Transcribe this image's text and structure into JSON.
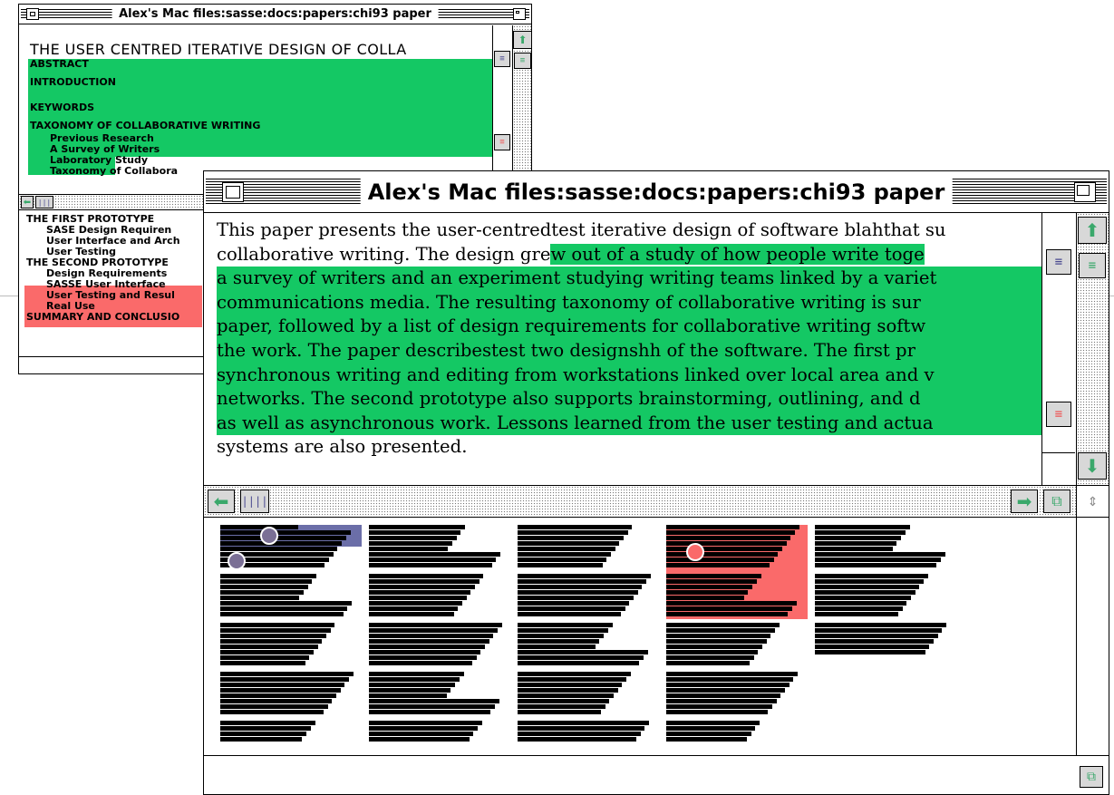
{
  "colors": {
    "highlight_green": "#14c864",
    "highlight_red": "#fa6a6a",
    "overview_purple": "#6b6ea8",
    "scroll_green": "#3aa86b"
  },
  "outline_window": {
    "title": "Alex's Mac files:sasse:docs:papers:chi93 paper",
    "heading": "THE USER CENTRED ITERATIVE DESIGN OF COLLA",
    "items_top": [
      {
        "label": "ABSTRACT",
        "level": 0
      },
      {
        "label": "INTRODUCTION",
        "level": 0
      },
      {
        "label": "KEYWORDS",
        "level": 0
      },
      {
        "label": "TAXONOMY OF COLLABORATIVE WRITING",
        "level": 0
      },
      {
        "label": "Previous Research",
        "level": 1
      },
      {
        "label": "A Survey  of Writers",
        "level": 1
      },
      {
        "label": "Laboratory Study",
        "level": 1
      },
      {
        "label": "Taxonomy of Collabora",
        "level": 1
      }
    ],
    "items_bottom": [
      {
        "label": "THE FIRST PROTOTYPE",
        "level": 0
      },
      {
        "label": "SASE Design Requiren",
        "level": 1
      },
      {
        "label": "User Interface and Arch",
        "level": 1
      },
      {
        "label": "User Testing",
        "level": 1
      },
      {
        "label": "THE SECOND PROTOTYPE",
        "level": 0
      },
      {
        "label": "Design Requirements",
        "level": 1
      },
      {
        "label": "SASSE User Interface",
        "level": 1
      },
      {
        "label": "User Testing and Resul",
        "level": 1
      },
      {
        "label": "Real Use",
        "level": 1
      },
      {
        "label": "SUMMARY AND CONCLUSIO",
        "level": 0
      }
    ]
  },
  "document_window": {
    "title": "Alex's Mac files:sasse:docs:papers:chi93 paper",
    "text_lines": [
      {
        "plain": "This paper presents the user-centredtest iterative design of software blahthat su",
        "hl": ""
      },
      {
        "plain": "collaborative writing.  The design gre",
        "hl": "w out of a study of how people write toge"
      },
      {
        "plain": "",
        "hl": "a survey of writers and an experiment studying writing teams linked by a variet"
      },
      {
        "plain": "",
        "hl": "communications media.  The resulting taxonomy of collaborative writing is sur"
      },
      {
        "plain": "",
        "hl": "paper, followed by a list of design requirements for collaborative writing softw"
      },
      {
        "plain": "",
        "hl": "the work.  The paper describestest two designshh of the software.  The  first pr"
      },
      {
        "plain": "",
        "hl": "synchronous writing and editing from workstations linked over local area and v"
      },
      {
        "plain": "",
        "hl": "networks.  The second prototype also supports brainstorming, outlining, and d"
      },
      {
        "plain": "",
        "hl": "as well as asynchronous work.  Lessons learned from the user testing and actua"
      },
      {
        "plain": "systems are also presented.",
        "hl": ""
      }
    ]
  }
}
